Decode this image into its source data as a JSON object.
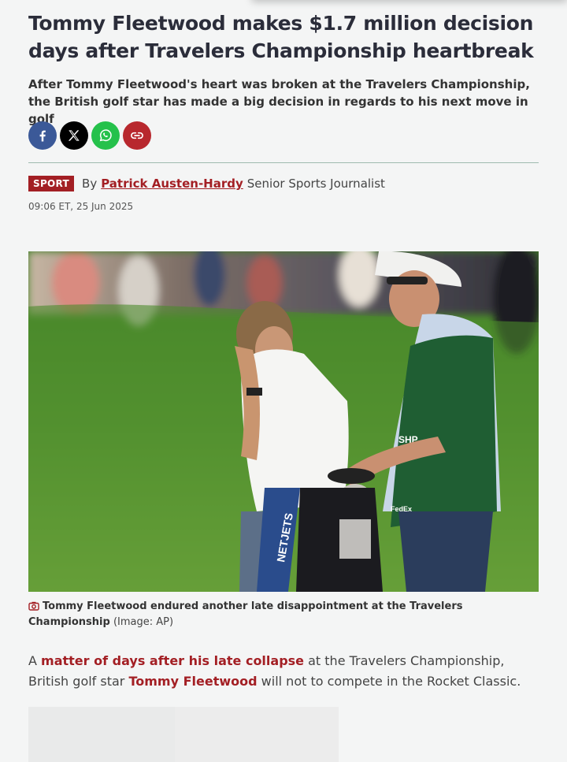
{
  "article": {
    "headline": "Tommy Fleetwood makes $1.7 million decision days after Travelers Championship heartbreak",
    "standfirst": "After Tommy Fleetwood's heart was broken at the Travelers Championship, the British golf star has made a big decision in regards to his next move in golf",
    "share": [
      {
        "name": "facebook",
        "icon": "facebook-icon"
      },
      {
        "name": "x",
        "icon": "x-icon"
      },
      {
        "name": "whatsapp",
        "icon": "whatsapp-icon"
      },
      {
        "name": "copy-link",
        "icon": "link-icon"
      }
    ],
    "section_badge": "SPORT",
    "by_prefix": "By",
    "author": "Patrick Austen-Hardy",
    "author_role": "Senior Sports Journalist",
    "timestamp": "09:06 ET, 25 Jun 2025",
    "image": {
      "caption": "Tommy Fleetwood endured another late disappointment at the Travelers Championship",
      "credit": "(Image: AP)",
      "bag_text": "NETJETS",
      "vest_text": "SHP",
      "sponsor_text": "FedEx"
    },
    "body": {
      "lead_a": "A ",
      "link_1": "matter of days after his late collapse",
      "lead_b": " at the Travelers Championship, British golf star ",
      "link_2": "Tommy Fleetwood",
      "lead_c": " will not to compete in the Rocket Classic."
    }
  },
  "colors": {
    "accent": "#a31f24",
    "facebook": "#3b5998",
    "x": "#000000",
    "whatsapp": "#25c14b",
    "link": "#b8282e"
  }
}
